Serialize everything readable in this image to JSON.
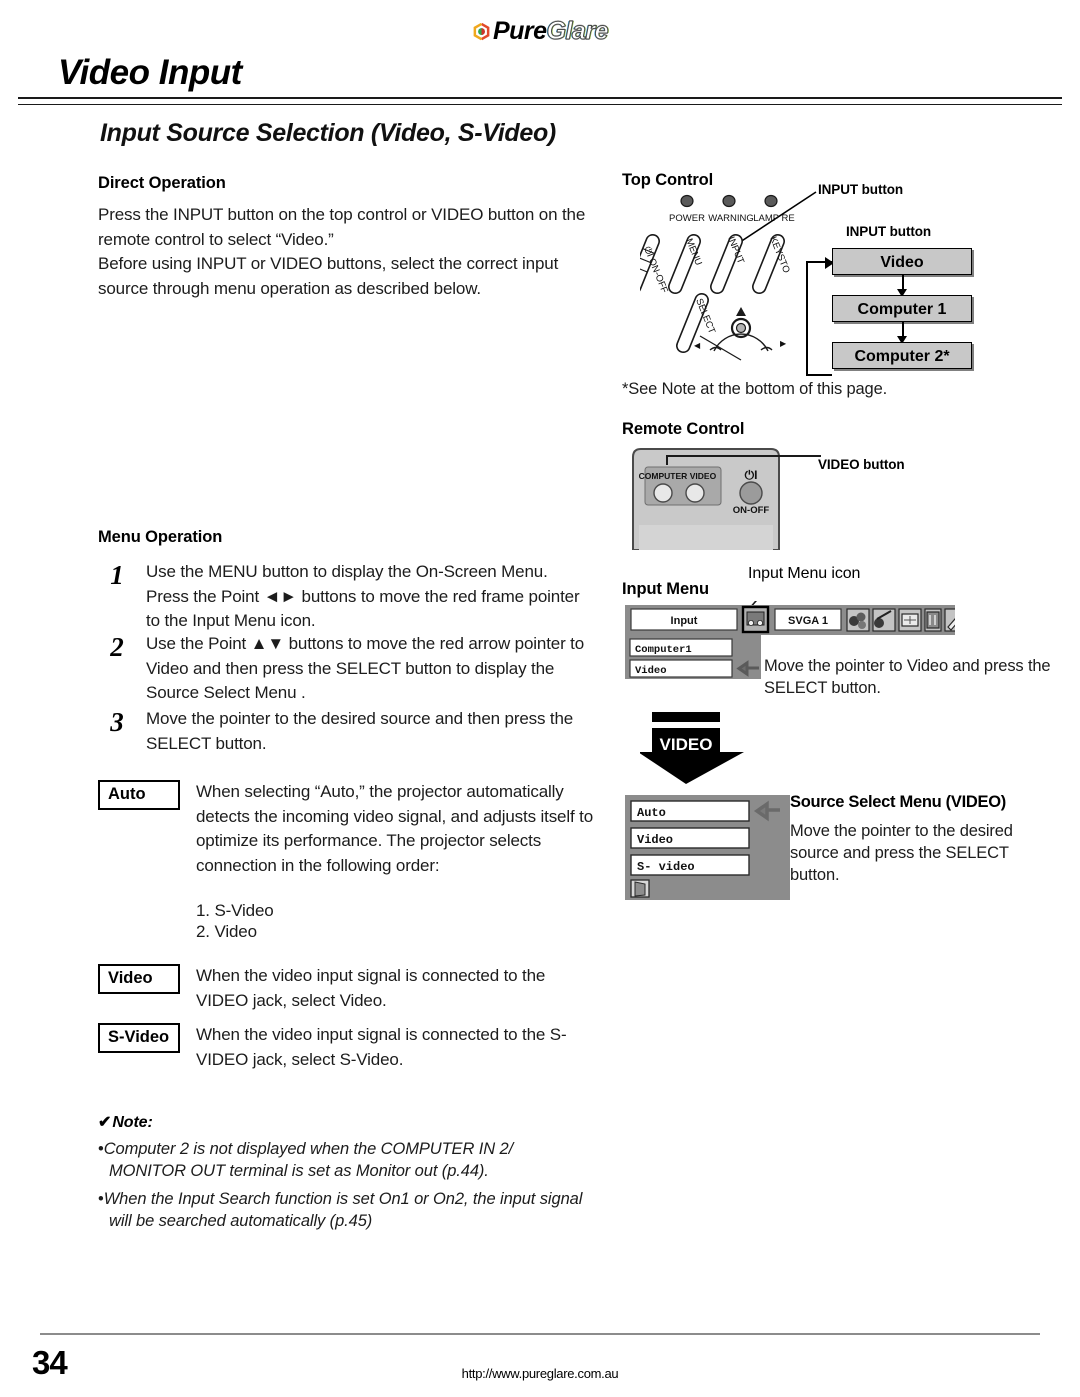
{
  "brand": {
    "mark": "pureglare-hexagon-icon",
    "name_part1": "Pure",
    "name_part2": "Glare"
  },
  "header": {
    "page_title": "Video Input",
    "section_title": "Input Source Selection (Video, S-Video)"
  },
  "left": {
    "direct_operation": {
      "heading": "Direct Operation",
      "body": "Press the INPUT button on the top control or VIDEO button on the remote control to select “Video.”\nBefore using INPUT or VIDEO buttons, select the correct input source through menu operation as described below."
    },
    "menu_operation": {
      "heading": "Menu Operation",
      "steps": [
        {
          "number": "1",
          "text": "Use the MENU button to display the On-Screen Menu. Press the Point ◄► buttons to move the red frame pointer to the Input Menu icon."
        },
        {
          "number": "2",
          "text": "Use the Point ▲▼ buttons to move the red arrow pointer to Video and then press the SELECT button to display the Source Select Menu ."
        },
        {
          "number": "3",
          "text": "Move the pointer to the desired source and then press the SELECT button."
        }
      ]
    },
    "terms": [
      {
        "label": "Auto",
        "text": "When selecting “Auto,” the projector automatically detects the incoming video signal, and adjusts itself to optimize its performance. The projector selects connection in the following order:",
        "order": [
          "1. S-Video",
          "2. Video"
        ]
      },
      {
        "label": "Video",
        "text": "When the video input signal is connected to the VIDEO jack, select Video."
      },
      {
        "label": "S-Video",
        "text": "When the video input signal is connected to the S-VIDEO jack, select S-Video."
      }
    ],
    "note": {
      "check_glyph": "✔",
      "heading": "Note:",
      "items": [
        "Computer 2 is not displayed when the COMPUTER IN 2/ MONITOR OUT terminal is set as Monitor out (p.44).",
        "When the Input Search function is set On1 or On2, the input signal will be searched automatically (p.45)"
      ]
    }
  },
  "right": {
    "top_control": {
      "heading": "Top Control",
      "callout_1": "INPUT button",
      "callout_2": "INPUT button",
      "indicator_labels": [
        "POWER",
        "WARNING",
        "LAMP RE"
      ],
      "key_labels": [
        "ON-OFF",
        "MENU",
        "INPUT",
        "KEYSTO",
        "SELECT"
      ],
      "flow_boxes": [
        "Video",
        "Computer 1",
        "Computer 2*"
      ],
      "see_note": "*See Note at the bottom of this page."
    },
    "remote_control": {
      "heading": "Remote Control",
      "callout": "VIDEO button",
      "button_labels": [
        "COMPUTER",
        "VIDEO"
      ],
      "power_symbol": "⏻|",
      "power_label": "ON-OFF"
    },
    "input_menu": {
      "heading": "Input Menu",
      "icon_callout": "Input Menu icon",
      "menubar_title": "Input",
      "menubar_value": "SVGA 1",
      "menubar_icons": [
        "input-source-icon",
        "color-adjust-icon",
        "image-select-icon",
        "screen-size-icon",
        "setting-icon",
        "pen-icon"
      ],
      "items": [
        "Computer1",
        "Video"
      ],
      "selected_item": "Video",
      "instruction": "Move the pointer to Video and press the SELECT button."
    },
    "video_banner": {
      "label": "VIDEO"
    },
    "source_select": {
      "heading": "Source Select Menu (VIDEO)",
      "items": [
        "Auto",
        "Video",
        "S- video"
      ],
      "selected_item": "Auto",
      "exit_icon": "exit-door-icon",
      "instruction": "Move the pointer to the desired source and press the SELECT button."
    }
  },
  "footer": {
    "page_number": "34",
    "url": "http://www.pureglare.com.au"
  },
  "colors": {
    "osd_panel": "#8c8c8c",
    "flow_box": "#c8c8c8",
    "rule": "#8c8c8c",
    "text": "#1c1c1c"
  }
}
